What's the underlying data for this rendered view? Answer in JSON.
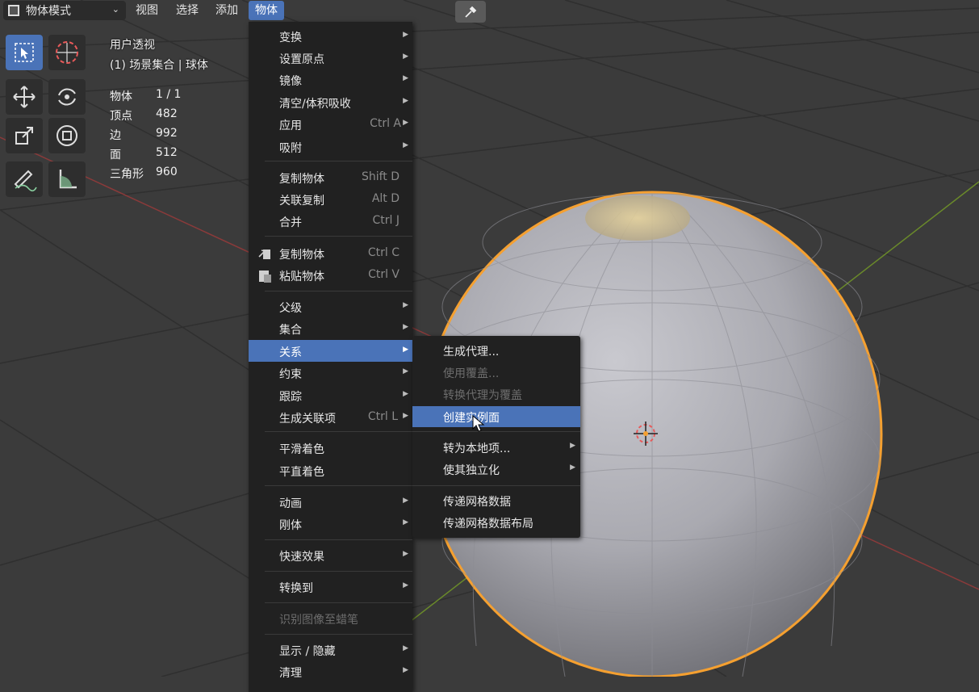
{
  "header": {
    "mode": "物体模式",
    "menus": [
      "视图",
      "选择",
      "添加",
      "物体"
    ]
  },
  "overlay": {
    "view_name": "用户透视",
    "collection": "(1) 场景集合 | 球体",
    "stats": [
      {
        "label": "物体",
        "value": "1 / 1"
      },
      {
        "label": "顶点",
        "value": "482"
      },
      {
        "label": "边",
        "value": "992"
      },
      {
        "label": "面",
        "value": "512"
      },
      {
        "label": "三角形",
        "value": "960"
      }
    ]
  },
  "object_menu": {
    "items": [
      {
        "label": "变换",
        "shortcut": "",
        "submenu": true
      },
      {
        "label": "设置原点",
        "shortcut": "",
        "submenu": true
      },
      {
        "label": "镜像",
        "shortcut": "",
        "submenu": true
      },
      {
        "label": "清空/体积吸收",
        "shortcut": "",
        "submenu": true
      },
      {
        "label": "应用",
        "shortcut": "Ctrl A",
        "submenu": true
      },
      {
        "label": "吸附",
        "shortcut": "",
        "submenu": true
      },
      {
        "label": "复制物体",
        "shortcut": "Shift D",
        "submenu": false
      },
      {
        "label": "关联复制",
        "shortcut": "Alt D",
        "submenu": false
      },
      {
        "label": "合并",
        "shortcut": "Ctrl J",
        "submenu": false
      },
      {
        "label": "复制物体",
        "shortcut": "Ctrl C",
        "submenu": false,
        "icon": "copy-icon"
      },
      {
        "label": "粘贴物体",
        "shortcut": "Ctrl V",
        "submenu": false,
        "icon": "paste-icon"
      },
      {
        "label": "父级",
        "shortcut": "",
        "submenu": true
      },
      {
        "label": "集合",
        "shortcut": "",
        "submenu": true
      },
      {
        "label": "关系",
        "shortcut": "",
        "submenu": true,
        "highlighted": true
      },
      {
        "label": "约束",
        "shortcut": "",
        "submenu": true
      },
      {
        "label": "跟踪",
        "shortcut": "",
        "submenu": true
      },
      {
        "label": "生成关联项",
        "shortcut": "Ctrl L",
        "submenu": true
      },
      {
        "label": "平滑着色",
        "shortcut": "",
        "submenu": false
      },
      {
        "label": "平直着色",
        "shortcut": "",
        "submenu": false
      },
      {
        "label": "动画",
        "shortcut": "",
        "submenu": true
      },
      {
        "label": "刚体",
        "shortcut": "",
        "submenu": true
      },
      {
        "label": "快速效果",
        "shortcut": "",
        "submenu": true
      },
      {
        "label": "转换到",
        "shortcut": "",
        "submenu": true
      },
      {
        "label": "识别图像至蜡笔",
        "shortcut": "",
        "submenu": false,
        "disabled": true
      },
      {
        "label": "显示 / 隐藏",
        "shortcut": "",
        "submenu": true
      },
      {
        "label": "清理",
        "shortcut": "",
        "submenu": true
      }
    ]
  },
  "relations_submenu": {
    "items": [
      {
        "label": "生成代理...",
        "submenu": false
      },
      {
        "label": "使用覆盖...",
        "submenu": false,
        "disabled": true
      },
      {
        "label": "转换代理为覆盖",
        "submenu": false,
        "disabled": true
      },
      {
        "label": "创建实例面",
        "submenu": false,
        "highlighted": true
      },
      {
        "label": "转为本地项...",
        "submenu": true
      },
      {
        "label": "使其独立化",
        "submenu": true
      },
      {
        "label": "传递网格数据",
        "submenu": false
      },
      {
        "label": "传递网格数据布局",
        "submenu": false
      }
    ]
  },
  "colors": {
    "accent": "#4a73b8",
    "menu_bg": "#212121",
    "viewport_bg": "#3b3b3b",
    "selection_outline": "#f5a030"
  }
}
